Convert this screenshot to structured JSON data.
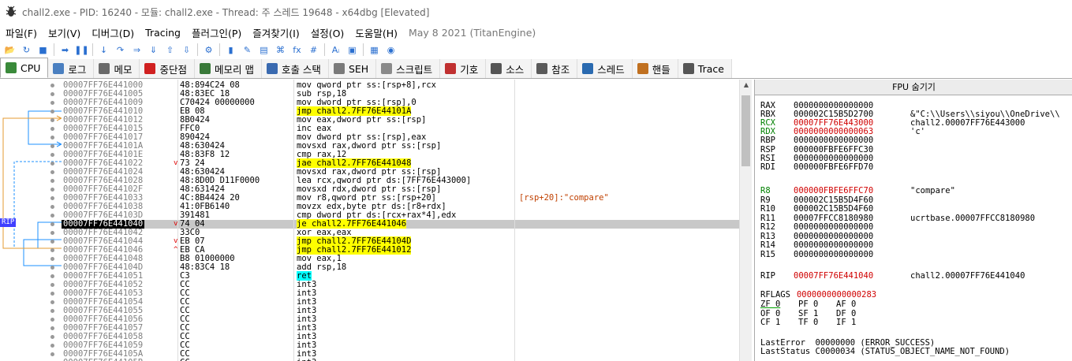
{
  "title": "chall2.exe - PID: 16240 - 모듈: chall2.exe - Thread: 주 스레드 19648 - x64dbg [Elevated]",
  "menu": [
    "파일(F)",
    "보기(V)",
    "디버그(D)",
    "Tracing",
    "플러그인(P)",
    "즐겨찾기(I)",
    "설정(O)",
    "도움말(H)"
  ],
  "build_info": "May 8 2021 (TitanEngine)",
  "toolbar_icons": [
    "open-icon",
    "restart-icon",
    "stop-icon",
    "run-icon",
    "pause-icon",
    "step-into-icon",
    "step-over-icon",
    "trace-into-icon",
    "trace-over-icon",
    "execute-till-return-icon",
    "run-to-user-code-icon",
    "scylla-icon",
    "patch-icon",
    "comment-icon",
    "label-icon",
    "bookmark-icon",
    "function-icon",
    "hash-icon",
    "strings-icon",
    "calculator-icon",
    "notes-icon",
    "globe-icon"
  ],
  "toolbar_glyphs": [
    "📂",
    "↻",
    "■",
    "➡",
    "❚❚",
    "↓",
    "↷",
    "⇒",
    "⇓",
    "⇧",
    "⇩",
    "⚙",
    "▮",
    "✎",
    "▤",
    "⌘",
    "fx",
    "#",
    "Aᵢ",
    "▣",
    "▦",
    "◉"
  ],
  "tabs": [
    {
      "label": "CPU",
      "color": "#3a8a3a"
    },
    {
      "label": "로그",
      "color": "#4a7fc0"
    },
    {
      "label": "메모",
      "color": "#6a6a6a"
    },
    {
      "label": "중단점",
      "color": "#d02020"
    },
    {
      "label": "메모리 맵",
      "color": "#3a7a3a"
    },
    {
      "label": "호출 스택",
      "color": "#3a6ab0"
    },
    {
      "label": "SEH",
      "color": "#7a7a7a"
    },
    {
      "label": "스크립트",
      "color": "#8a8a8a"
    },
    {
      "label": "기호",
      "color": "#c03030"
    },
    {
      "label": "소스",
      "color": "#555555"
    },
    {
      "label": "참조",
      "color": "#5a5a5a"
    },
    {
      "label": "스레드",
      "color": "#2a6ab0"
    },
    {
      "label": "핸들",
      "color": "#c07020"
    },
    {
      "label": "Trace",
      "color": "#555555"
    }
  ],
  "rip_label": "RIP",
  "disasm": [
    {
      "addr": "00007FF76E441000",
      "bytes": "48:894C24 08",
      "instr": "mov qword ptr ss:[rsp+8],rcx",
      "mark": "",
      "cmt": ""
    },
    {
      "addr": "00007FF76E441005",
      "bytes": "48:83EC 18",
      "instr": "sub rsp,18",
      "mark": "",
      "cmt": ""
    },
    {
      "addr": "00007FF76E441009",
      "bytes": "C70424 00000000",
      "instr": "mov dword ptr ss:[rsp],0",
      "mark": "",
      "cmt": ""
    },
    {
      "addr": "00007FF76E441010",
      "bytes": "EB 08",
      "instr": "jmp chall2.7FF76E44101A",
      "mark": "",
      "cmt": "",
      "hl": "y"
    },
    {
      "addr": "00007FF76E441012",
      "bytes": "8B0424",
      "instr": "mov eax,dword ptr ss:[rsp]",
      "mark": "",
      "cmt": ""
    },
    {
      "addr": "00007FF76E441015",
      "bytes": "FFC0",
      "instr": "inc eax",
      "mark": "",
      "cmt": ""
    },
    {
      "addr": "00007FF76E441017",
      "bytes": "890424",
      "instr": "mov dword ptr ss:[rsp],eax",
      "mark": "",
      "cmt": ""
    },
    {
      "addr": "00007FF76E44101A",
      "bytes": "48:630424",
      "instr": "movsxd rax,dword ptr ss:[rsp]",
      "mark": "",
      "cmt": ""
    },
    {
      "addr": "00007FF76E44101E",
      "bytes": "48:83F8 12",
      "instr": "cmp rax,12",
      "mark": "",
      "cmt": ""
    },
    {
      "addr": "00007FF76E441022",
      "bytes": "73 24",
      "instr": "jae chall2.7FF76E441048",
      "mark": "v",
      "cmt": "",
      "hl": "y"
    },
    {
      "addr": "00007FF76E441024",
      "bytes": "48:630424",
      "instr": "movsxd rax,dword ptr ss:[rsp]",
      "mark": "",
      "cmt": ""
    },
    {
      "addr": "00007FF76E441028",
      "bytes": "48:8D0D D11F0000",
      "instr": "lea rcx,qword ptr ds:[7FF76E443000]",
      "mark": "",
      "cmt": ""
    },
    {
      "addr": "00007FF76E44102F",
      "bytes": "48:631424",
      "instr": "movsxd rdx,dword ptr ss:[rsp]",
      "mark": "",
      "cmt": ""
    },
    {
      "addr": "00007FF76E441033",
      "bytes": "4C:8B4424 20",
      "instr": "mov r8,qword ptr ss:[rsp+20]",
      "mark": "",
      "cmt": "[rsp+20]:\"compare\""
    },
    {
      "addr": "00007FF76E441038",
      "bytes": "41:0FB6140",
      "instr": "movzx edx,byte ptr ds:[r8+rdx]",
      "mark": "",
      "cmt": ""
    },
    {
      "addr": "00007FF76E44103D",
      "bytes": "391481",
      "instr": "cmp dword ptr ds:[rcx+rax*4],edx",
      "mark": "",
      "cmt": ""
    },
    {
      "addr": "00007FF76E441040",
      "bytes": "74 04",
      "instr": "je chall2.7FF76E441046",
      "mark": "v",
      "cmt": "",
      "hl": "y",
      "cur": true
    },
    {
      "addr": "00007FF76E441042",
      "bytes": "33C0",
      "instr": "xor eax,eax",
      "mark": "",
      "cmt": ""
    },
    {
      "addr": "00007FF76E441044",
      "bytes": "EB 07",
      "instr": "jmp chall2.7FF76E44104D",
      "mark": "v",
      "cmt": "",
      "hl": "y"
    },
    {
      "addr": "00007FF76E441046",
      "bytes": "EB CA",
      "instr": "jmp chall2.7FF76E441012",
      "mark": "^",
      "cmt": "",
      "hl": "y"
    },
    {
      "addr": "00007FF76E441048",
      "bytes": "B8 01000000",
      "instr": "mov eax,1",
      "mark": "",
      "cmt": ""
    },
    {
      "addr": "00007FF76E44104D",
      "bytes": "48:83C4 18",
      "instr": "add rsp,18",
      "mark": "",
      "cmt": ""
    },
    {
      "addr": "00007FF76E441051",
      "bytes": "C3",
      "instr": "ret",
      "mark": "",
      "cmt": "",
      "hl": "c"
    },
    {
      "addr": "00007FF76E441052",
      "bytes": "CC",
      "instr": "int3",
      "mark": "",
      "cmt": ""
    },
    {
      "addr": "00007FF76E441053",
      "bytes": "CC",
      "instr": "int3",
      "mark": "",
      "cmt": ""
    },
    {
      "addr": "00007FF76E441054",
      "bytes": "CC",
      "instr": "int3",
      "mark": "",
      "cmt": ""
    },
    {
      "addr": "00007FF76E441055",
      "bytes": "CC",
      "instr": "int3",
      "mark": "",
      "cmt": ""
    },
    {
      "addr": "00007FF76E441056",
      "bytes": "CC",
      "instr": "int3",
      "mark": "",
      "cmt": ""
    },
    {
      "addr": "00007FF76E441057",
      "bytes": "CC",
      "instr": "int3",
      "mark": "",
      "cmt": ""
    },
    {
      "addr": "00007FF76E441058",
      "bytes": "CC",
      "instr": "int3",
      "mark": "",
      "cmt": ""
    },
    {
      "addr": "00007FF76E441059",
      "bytes": "CC",
      "instr": "int3",
      "mark": "",
      "cmt": ""
    },
    {
      "addr": "00007FF76E44105A",
      "bytes": "CC",
      "instr": "int3",
      "mark": "",
      "cmt": ""
    },
    {
      "addr": "00007FF76E44105B",
      "bytes": "CC",
      "instr": "int3",
      "mark": "",
      "cmt": ""
    }
  ],
  "fpu_header": "FPU 숨기기",
  "registers_group1": [
    {
      "name": "RAX",
      "value": "0000000000000000",
      "comment": "",
      "changed": false
    },
    {
      "name": "RBX",
      "value": "000002C15B5D2700",
      "comment": "&\"C:\\\\Users\\\\siyou\\\\OneDrive\\\\",
      "changed": false
    },
    {
      "name": "RCX",
      "value": "00007FF76E443000",
      "comment": "chall2.00007FF76E443000",
      "changed": true
    },
    {
      "name": "RDX",
      "value": "0000000000000063",
      "comment": "'c'",
      "changed": true
    },
    {
      "name": "RBP",
      "value": "0000000000000000",
      "comment": "",
      "changed": false
    },
    {
      "name": "RSP",
      "value": "000000FBFE6FFC30",
      "comment": "",
      "changed": false
    },
    {
      "name": "RSI",
      "value": "0000000000000000",
      "comment": "",
      "changed": false
    },
    {
      "name": "RDI",
      "value": "000000FBFE6FFD70",
      "comment": "",
      "changed": false
    }
  ],
  "registers_group2": [
    {
      "name": "R8",
      "value": "000000FBFE6FFC70",
      "comment": "\"compare\"",
      "changed": true
    },
    {
      "name": "R9",
      "value": "000002C15B5D4F60",
      "comment": "",
      "changed": false
    },
    {
      "name": "R10",
      "value": "000002C15B5D4F60",
      "comment": "",
      "changed": false
    },
    {
      "name": "R11",
      "value": "00007FFCC8180980",
      "comment": "ucrtbase.00007FFCC8180980",
      "changed": false
    },
    {
      "name": "R12",
      "value": "0000000000000000",
      "comment": "",
      "changed": false
    },
    {
      "name": "R13",
      "value": "0000000000000000",
      "comment": "",
      "changed": false
    },
    {
      "name": "R14",
      "value": "0000000000000000",
      "comment": "",
      "changed": false
    },
    {
      "name": "R15",
      "value": "0000000000000000",
      "comment": "",
      "changed": false
    }
  ],
  "rip": {
    "name": "RIP",
    "value": "00007FF76E441040",
    "comment": "chall2.00007FF76E441040"
  },
  "rflags": {
    "name": "RFLAGS",
    "value": "0000000000000283"
  },
  "flags": [
    [
      "ZF 0",
      "PF 0",
      "AF 0"
    ],
    [
      "OF 0",
      "SF 1",
      "DF 0"
    ],
    [
      "CF 1",
      "TF 0",
      "IF 1"
    ]
  ],
  "last_error": "LastError  00000000 (ERROR_SUCCESS)",
  "last_status": "LastStatus C0000034 (STATUS_OBJECT_NAME_NOT_FOUND)"
}
